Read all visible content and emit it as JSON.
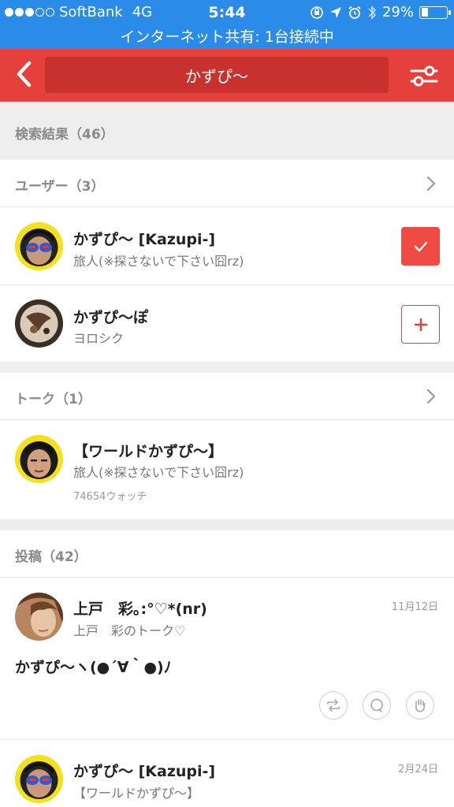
{
  "status_bar": {
    "carrier": "SoftBank",
    "network": "4G",
    "time": "5:44",
    "battery": "29%",
    "battery_level": 0.29,
    "tethering": "インターネット共有: 1台接続中"
  },
  "nav": {
    "query": "かずぴ〜"
  },
  "results": {
    "header": "検索結果（46）",
    "users_header": "ユーザー（3）",
    "users": [
      {
        "name": "かずぴ〜 [Kazupi-]",
        "status": "旅人(※探さないで下さい囧rz)",
        "following": true
      },
      {
        "name": "かずぴ〜ぽ",
        "status": "ヨロシク",
        "following": false
      }
    ],
    "talks_header": "トーク（1）",
    "talks": [
      {
        "title": "【ワールドかずぴ〜】",
        "description": "旅人(※探さないで下さい囧rz)",
        "watch": "74654ウォッチ"
      }
    ],
    "posts_header": "投稿（42）",
    "posts": [
      {
        "author": "上戸　彩｡:°♡*(nr)",
        "talk": "上戸　彩のトーク♡",
        "date": "11月12日",
        "body": "かずぴ〜ヽ(●´∀｀●)ﾉ"
      },
      {
        "author": "かずぴ〜 [Kazupi-]",
        "talk": "【ワールドかずぴ〜】",
        "date": "2月24日"
      }
    ]
  },
  "colors": {
    "status_bar": "#2b8be8",
    "nav_bar": "#e5403b",
    "accent": "#f04a44"
  }
}
